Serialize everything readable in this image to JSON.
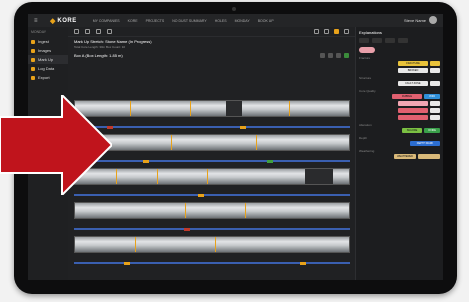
{
  "topbar": {
    "logo_text": "KORE",
    "nav": [
      "MY COMPANIES",
      "KORE",
      "PROJECTS",
      "NO DUST SUMMARY",
      "HOLES",
      "MONDAY",
      "BOOK UP"
    ],
    "user_name": "Steve Name"
  },
  "sidebar": {
    "header": "MONDAY",
    "items": [
      {
        "label": "Ingest",
        "icon": "upload-icon"
      },
      {
        "label": "Images",
        "icon": "image-icon"
      },
      {
        "label": "Mark Up",
        "icon": "pen-icon"
      },
      {
        "label": "Log Data",
        "icon": "table-icon"
      },
      {
        "label": "Export",
        "icon": "export-icon"
      }
    ]
  },
  "main": {
    "info_title": "Mark Up Stretch: Stone Name (In Progress)",
    "info_subtitle": "Total Core Length: 30m   Box Count: 10",
    "box_title": "Box A (Box Length: 1.85 m)"
  },
  "panel": {
    "title": "Explanations",
    "sections": [
      {
        "label": "Fracture",
        "chips": [
          "FRACTURE",
          "BROKEN"
        ]
      },
      {
        "label": "Structure",
        "chips": [
          "FAULT ZONE"
        ]
      },
      {
        "label": "Core Quality",
        "chips": [
          "RUBBLE",
          "VOID"
        ]
      },
      {
        "label": "Alteration",
        "chips": [
          "SULFIDE",
          "OXIDE"
        ]
      },
      {
        "label": "Depth",
        "chips": [
          "DEPTH MARK"
        ]
      },
      {
        "label": "Weathering",
        "chips": [
          "WEATHERED"
        ]
      }
    ]
  },
  "colors": {
    "accent": "#e8a21a",
    "arrow": "#c0141c"
  }
}
